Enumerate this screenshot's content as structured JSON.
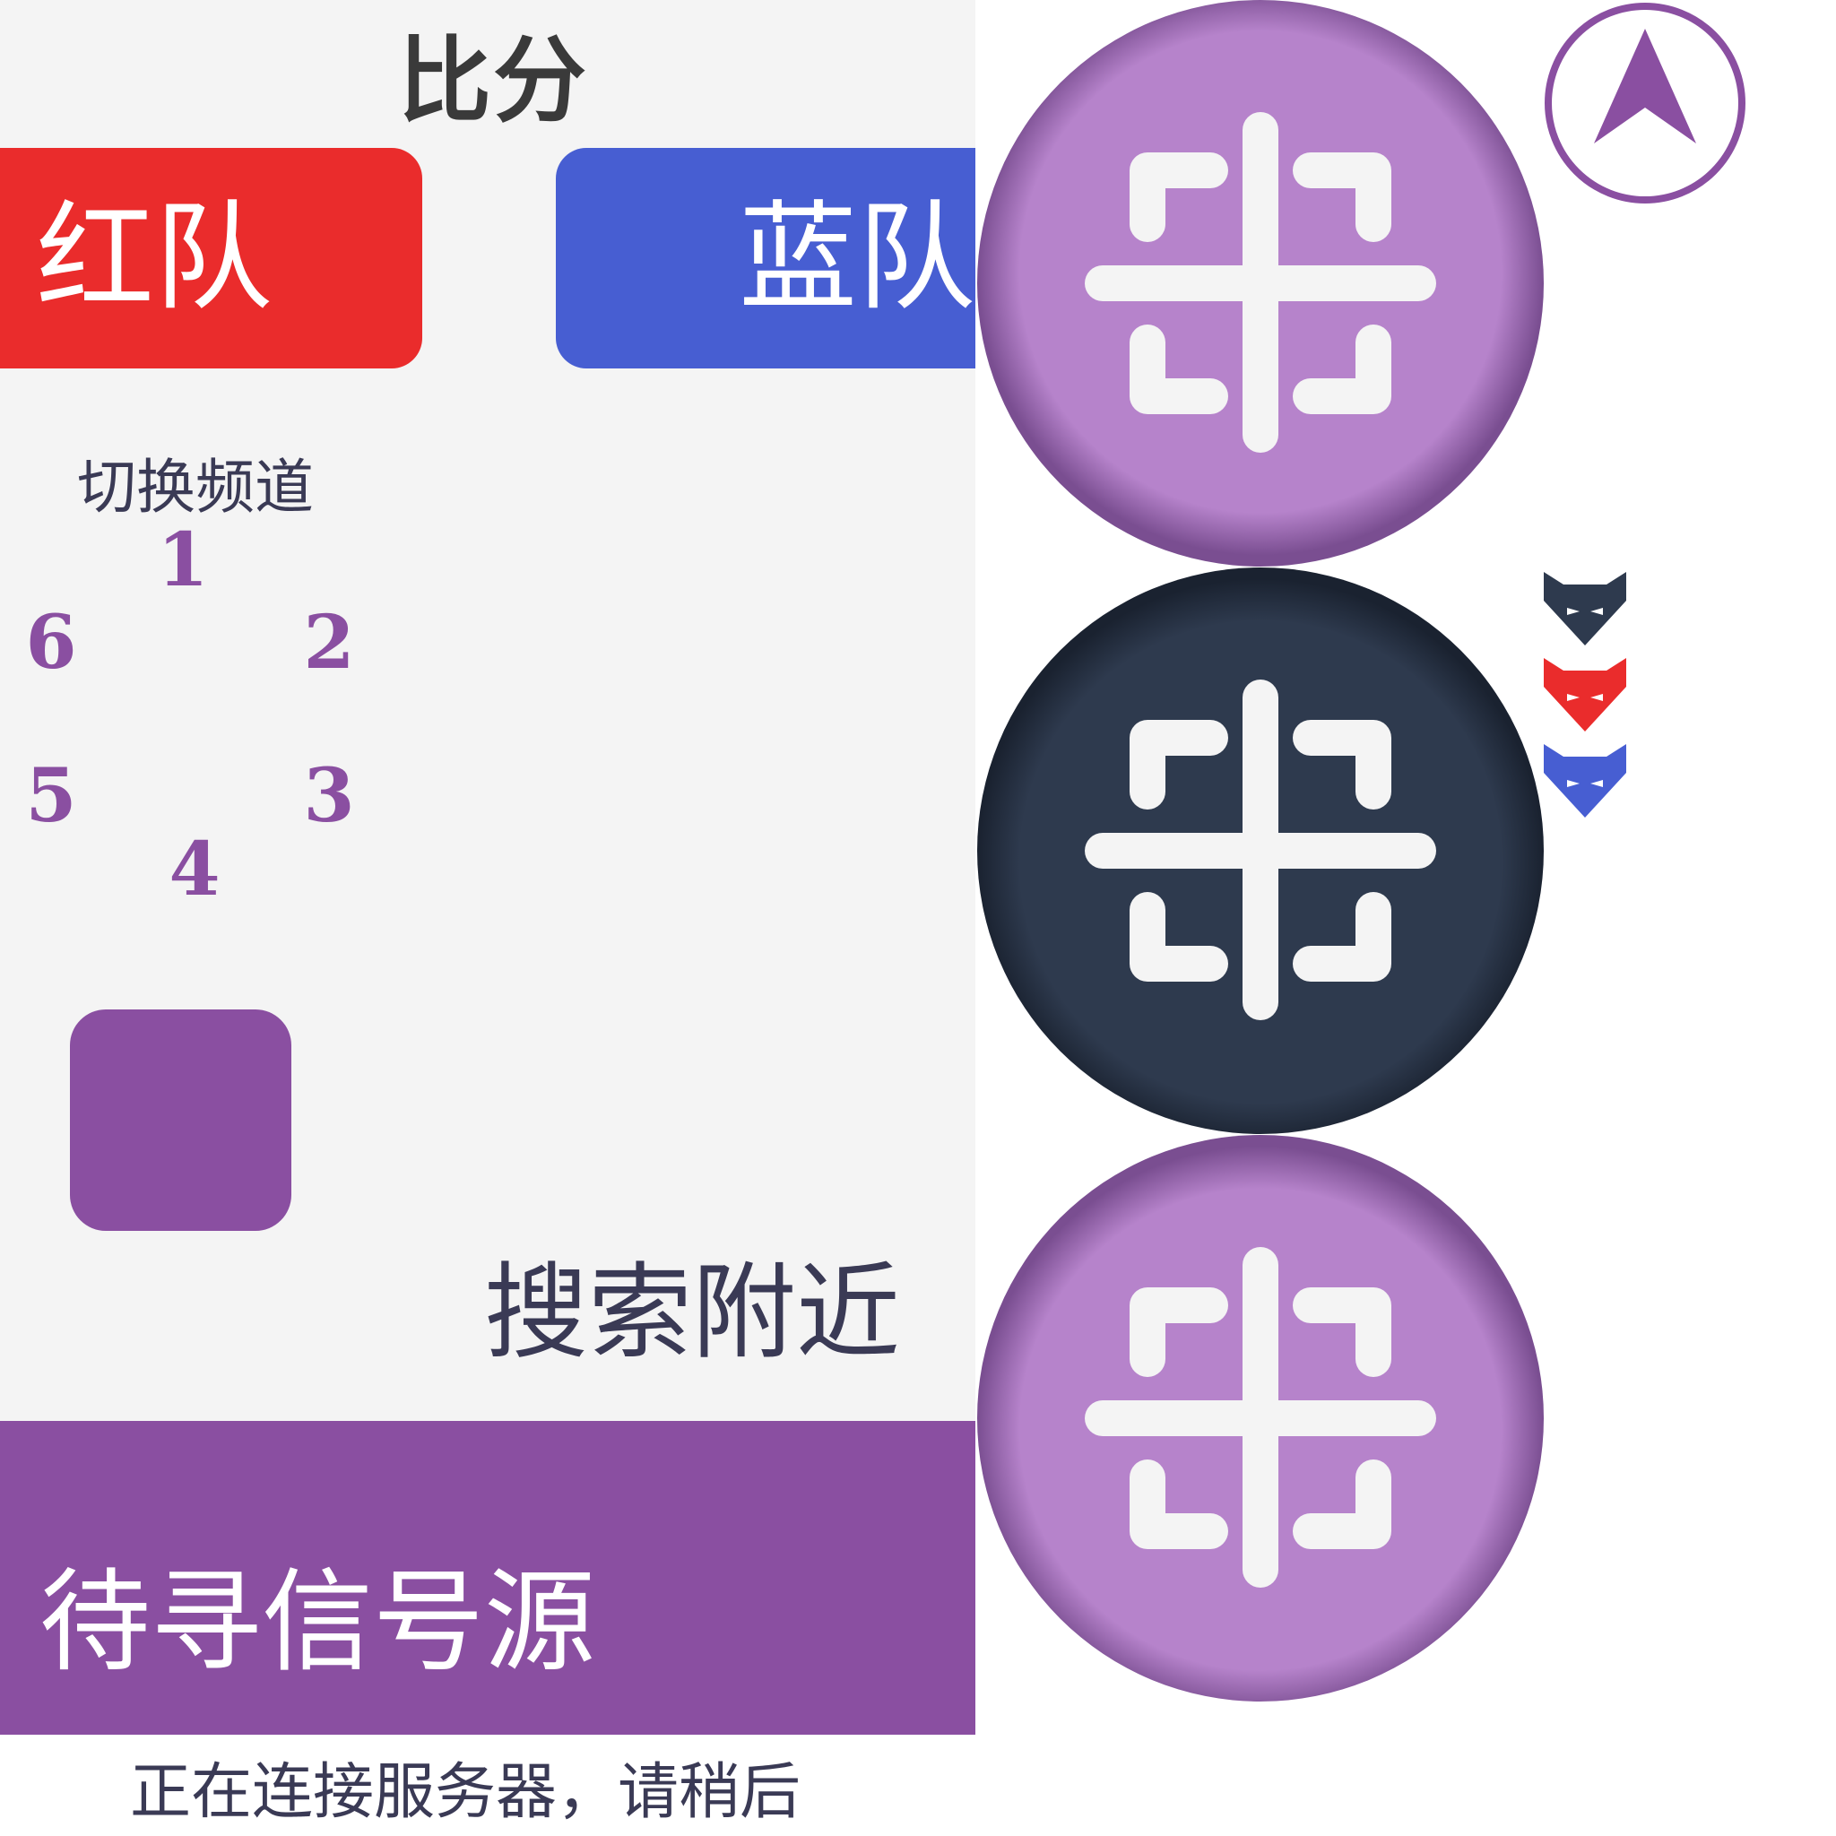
{
  "score": {
    "title": "比分"
  },
  "teams": {
    "red": "红队",
    "blue": "蓝队"
  },
  "channel": {
    "label": "切换频道",
    "numbers": [
      "1",
      "2",
      "3",
      "4",
      "5",
      "6"
    ]
  },
  "search": {
    "label": "搜索附近"
  },
  "signal": {
    "status": "待寻信号源"
  },
  "connection": {
    "message": "正在连接服务器，请稍后"
  },
  "icons": {
    "scan_buttons": [
      "crosshair-icon",
      "crosshair-icon",
      "crosshair-icon"
    ],
    "navigation": "navigation-arrow-icon",
    "markers": [
      "wolf-marker-dark-icon",
      "wolf-marker-red-icon",
      "wolf-marker-blue-icon"
    ]
  },
  "colors": {
    "accent": "#8a4fa1",
    "scan_light": "#b683cb",
    "scan_dark": "#2e3a4e",
    "red_team": "#ea2c2c",
    "blue_team": "#475ed2",
    "marker_dark": "#2e3a4e"
  }
}
